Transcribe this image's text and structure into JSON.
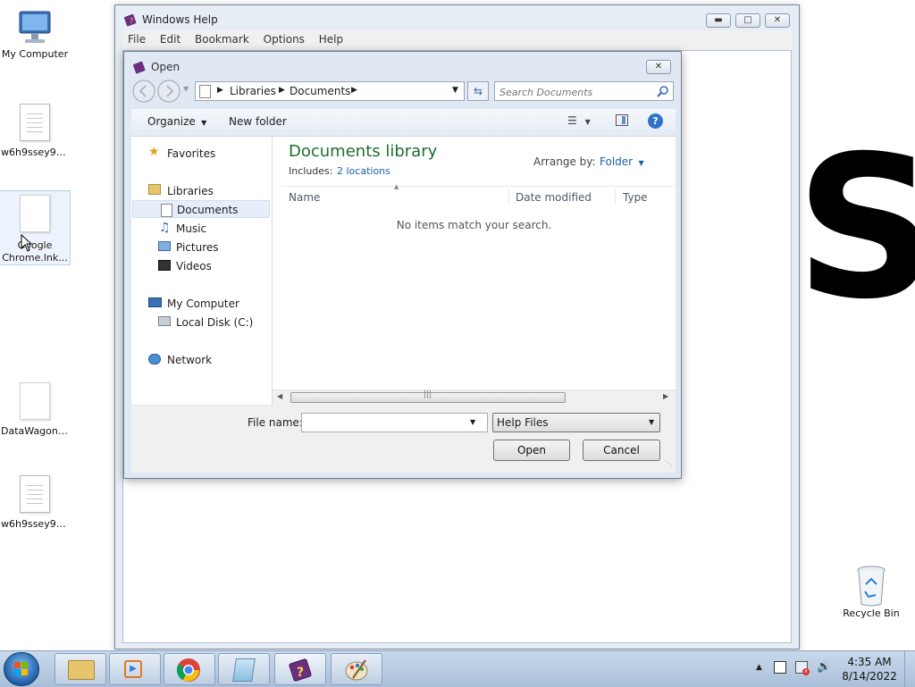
{
  "desktop": {
    "icons": [
      {
        "label": "My Computer"
      },
      {
        "label": "w6h9ssey9-..."
      },
      {
        "label": "Google Chrome.lnk..."
      },
      {
        "label": "DataWagon...."
      },
      {
        "label": "w6h9ssey9-..."
      },
      {
        "label": "Recycle Bin"
      }
    ]
  },
  "help_window": {
    "title": "Windows Help",
    "menu": [
      "File",
      "Edit",
      "Bookmark",
      "Options",
      "Help"
    ],
    "min_icon": "minimize-icon",
    "max_icon": "maximize-icon",
    "close_icon": "close-icon",
    "content_text": "S"
  },
  "open_dialog": {
    "title": "Open",
    "address": {
      "seg1": "Libraries",
      "seg2": "Documents"
    },
    "search_placeholder": "Search Documents",
    "toolbar": {
      "organize": "Organize",
      "new_folder": "New folder"
    },
    "nav": {
      "favorites": "Favorites",
      "libraries": "Libraries",
      "documents": "Documents",
      "music": "Music",
      "pictures": "Pictures",
      "videos": "Videos",
      "my_computer": "My Computer",
      "local_disk": "Local Disk (C:)",
      "network": "Network"
    },
    "library_title": "Documents library",
    "includes_label": "Includes:",
    "includes_link": "2 locations",
    "arrange_label": "Arrange by:",
    "arrange_value": "Folder",
    "columns": {
      "name": "Name",
      "date": "Date modified",
      "type": "Type"
    },
    "empty_message": "No items match your search.",
    "file_name_label": "File name:",
    "file_name_value": "",
    "filetype_value": "Help Files",
    "open_button": "Open",
    "cancel_button": "Cancel"
  },
  "taskbar": {
    "time": "4:35 AM",
    "date": "8/14/2022"
  },
  "colors": {
    "library_title": "#1e6e2e",
    "link": "#1a5fa8",
    "taskbar": "#b7cbe3"
  }
}
